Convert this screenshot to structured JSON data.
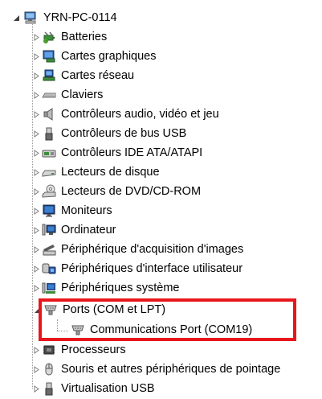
{
  "tree": {
    "root": {
      "label": "YRN-PC-0114",
      "icon": "computer-icon",
      "expanded": true
    },
    "categories": [
      {
        "label": "Batteries",
        "icon": "battery-icon"
      },
      {
        "label": "Cartes graphiques",
        "icon": "display-adapter-icon"
      },
      {
        "label": "Cartes réseau",
        "icon": "network-adapter-icon"
      },
      {
        "label": "Claviers",
        "icon": "keyboard-icon"
      },
      {
        "label": "Contrôleurs audio, vidéo et jeu",
        "icon": "audio-icon"
      },
      {
        "label": "Contrôleurs de bus USB",
        "icon": "usb-icon"
      },
      {
        "label": "Contrôleurs IDE ATA/ATAPI",
        "icon": "ide-controller-icon"
      },
      {
        "label": "Lecteurs de disque",
        "icon": "disk-drive-icon"
      },
      {
        "label": "Lecteurs de DVD/CD-ROM",
        "icon": "dvd-drive-icon"
      },
      {
        "label": "Moniteurs",
        "icon": "monitor-icon"
      },
      {
        "label": "Ordinateur",
        "icon": "computer-small-icon"
      },
      {
        "label": "Périphérique d'acquisition d'images",
        "icon": "scanner-icon"
      },
      {
        "label": "Périphériques d'interface utilisateur",
        "icon": "hid-icon"
      },
      {
        "label": "Périphériques système",
        "icon": "system-devices-icon"
      },
      {
        "label": "Ports (COM et LPT)",
        "icon": "port-icon",
        "expanded": true,
        "children": [
          {
            "label": "Communications Port (COM19)",
            "icon": "port-icon"
          }
        ]
      },
      {
        "label": "Processeurs",
        "icon": "processor-icon"
      },
      {
        "label": "Souris et autres périphériques de pointage",
        "icon": "mouse-icon"
      },
      {
        "label": "Virtualisation USB",
        "icon": "usb-icon"
      }
    ]
  },
  "colors": {
    "highlight": "#e8161c",
    "tree_lines": "#9a9a9a",
    "expander": "#7f7f7f"
  }
}
